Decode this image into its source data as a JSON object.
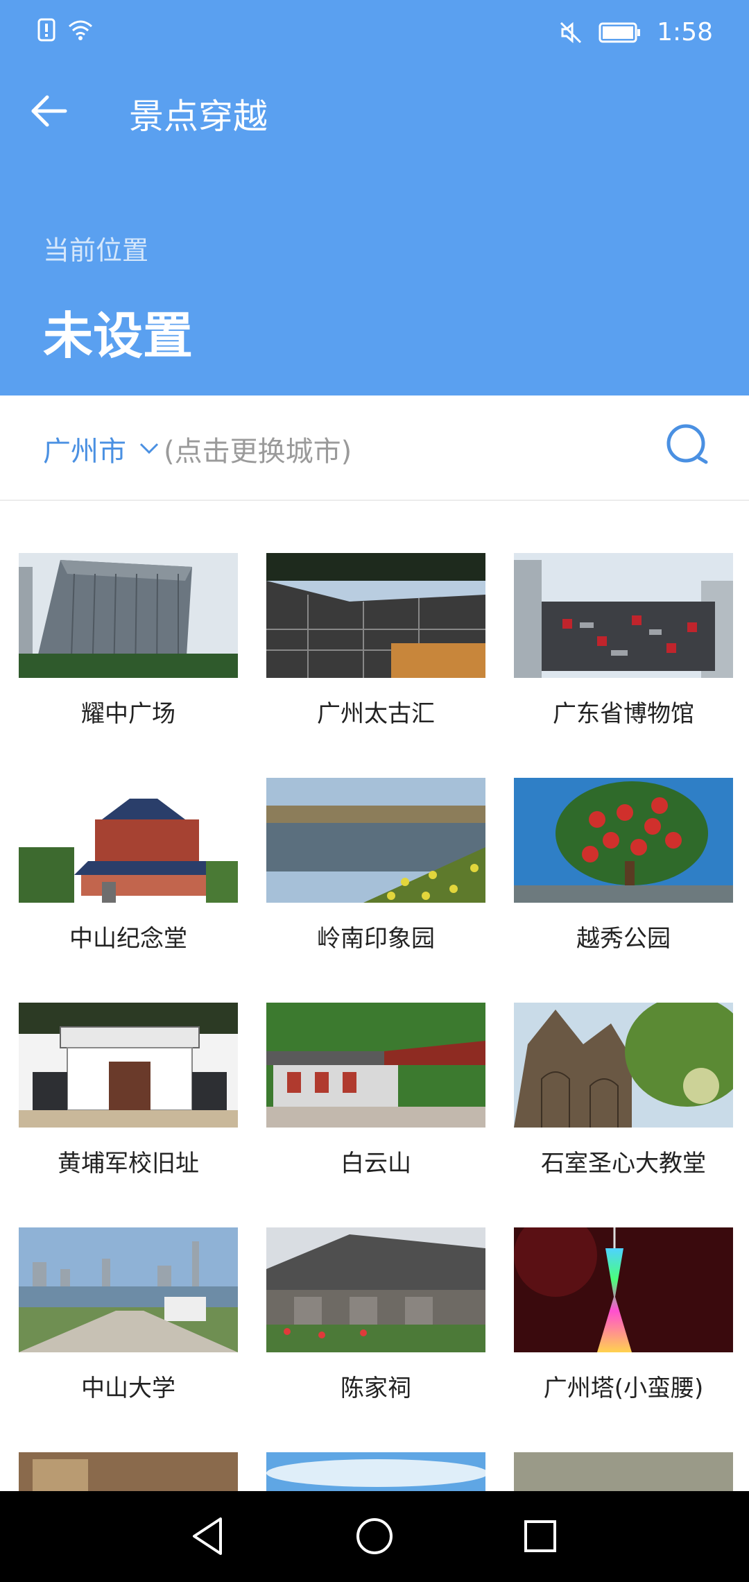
{
  "status": {
    "time": "1:58"
  },
  "header": {
    "title": "景点穿越",
    "location_label": "当前位置",
    "location_value": "未设置"
  },
  "city": {
    "name": "广州市",
    "hint": "(点击更换城市)"
  },
  "places": [
    {
      "name": "耀中广场"
    },
    {
      "name": "广州太古汇"
    },
    {
      "name": "广东省博物馆"
    },
    {
      "name": "中山纪念堂"
    },
    {
      "name": "岭南印象园"
    },
    {
      "name": "越秀公园"
    },
    {
      "name": "黄埔军校旧址"
    },
    {
      "name": "白云山"
    },
    {
      "name": "石室圣心大教堂"
    },
    {
      "name": "中山大学"
    },
    {
      "name": "陈家祠"
    },
    {
      "name": "广州塔(小蛮腰)"
    }
  ],
  "colors": {
    "header_bg": "#5aa0f0",
    "accent": "#4a90e2"
  }
}
